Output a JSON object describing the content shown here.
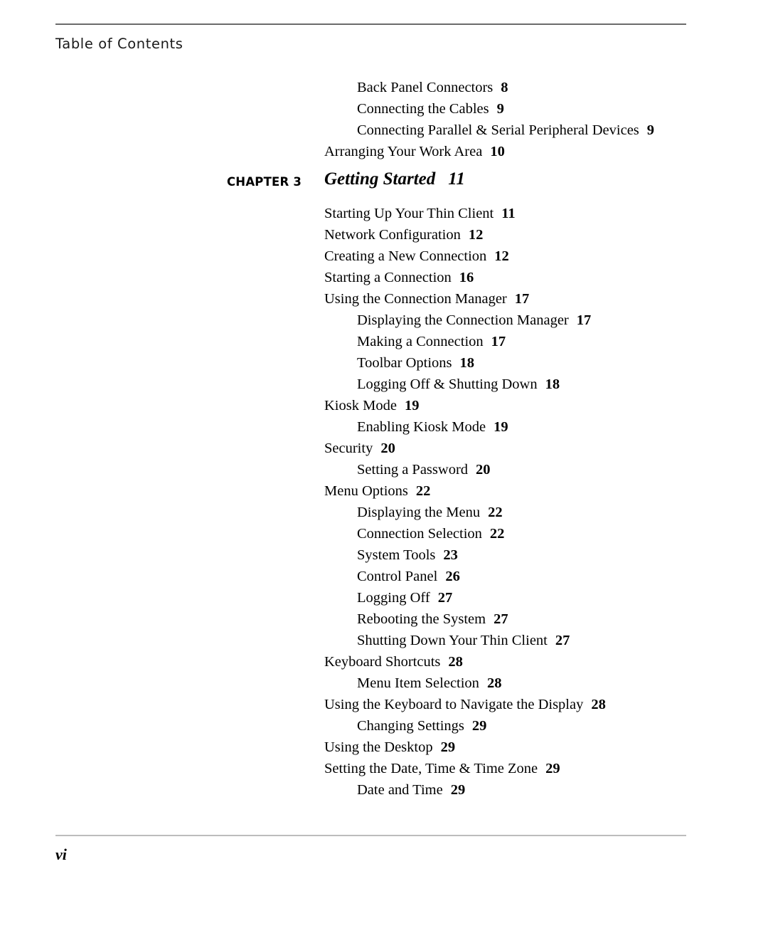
{
  "header": {
    "title": "Table of Contents",
    "rule_color": "#6b6b6b"
  },
  "chapter": {
    "label": "CHAPTER 3",
    "title": "Getting Started",
    "page": "11"
  },
  "entries_before_chapter": [
    {
      "title": "Back Panel Connectors",
      "page": "8",
      "level": 2
    },
    {
      "title": "Connecting the Cables",
      "page": "9",
      "level": 2
    },
    {
      "title": "Connecting Parallel & Serial Peripheral Devices",
      "page": "9",
      "level": 2
    },
    {
      "title": "Arranging Your Work Area",
      "page": "10",
      "level": 1
    }
  ],
  "entries_after_chapter": [
    {
      "title": "Starting Up Your Thin Client",
      "page": "11",
      "level": 1
    },
    {
      "title": "Network Configuration",
      "page": "12",
      "level": 1
    },
    {
      "title": "Creating a New Connection",
      "page": "12",
      "level": 1
    },
    {
      "title": "Starting a Connection",
      "page": "16",
      "level": 1
    },
    {
      "title": "Using the Connection Manager",
      "page": "17",
      "level": 1
    },
    {
      "title": "Displaying the Connection Manager",
      "page": "17",
      "level": 2
    },
    {
      "title": "Making a Connection",
      "page": "17",
      "level": 2
    },
    {
      "title": "Toolbar Options",
      "page": "18",
      "level": 2
    },
    {
      "title": "Logging Off & Shutting Down",
      "page": "18",
      "level": 2
    },
    {
      "title": "Kiosk Mode",
      "page": "19",
      "level": 1
    },
    {
      "title": "Enabling Kiosk Mode",
      "page": "19",
      "level": 2
    },
    {
      "title": "Security",
      "page": "20",
      "level": 1
    },
    {
      "title": "Setting a Password",
      "page": "20",
      "level": 2
    },
    {
      "title": "Menu Options",
      "page": "22",
      "level": 1
    },
    {
      "title": "Displaying the Menu",
      "page": "22",
      "level": 2
    },
    {
      "title": "Connection Selection",
      "page": "22",
      "level": 2
    },
    {
      "title": "System Tools",
      "page": "23",
      "level": 2
    },
    {
      "title": "Control Panel",
      "page": "26",
      "level": 2
    },
    {
      "title": "Logging Off",
      "page": "27",
      "level": 2
    },
    {
      "title": "Rebooting the System",
      "page": "27",
      "level": 2
    },
    {
      "title": "Shutting Down Your Thin Client",
      "page": "27",
      "level": 2
    },
    {
      "title": "Keyboard Shortcuts",
      "page": "28",
      "level": 1
    },
    {
      "title": "Menu Item Selection",
      "page": "28",
      "level": 2
    },
    {
      "title": "Using the Keyboard to Navigate the Display",
      "page": "28",
      "level": 1
    },
    {
      "title": "Changing Settings",
      "page": "29",
      "level": 2
    },
    {
      "title": "Using the Desktop",
      "page": "29",
      "level": 1
    },
    {
      "title": "Setting the Date, Time & Time Zone",
      "page": "29",
      "level": 1
    },
    {
      "title": "Date and Time",
      "page": "29",
      "level": 2
    }
  ],
  "footer": {
    "page_number": "vi",
    "rule_color": "#bdbdbd"
  }
}
